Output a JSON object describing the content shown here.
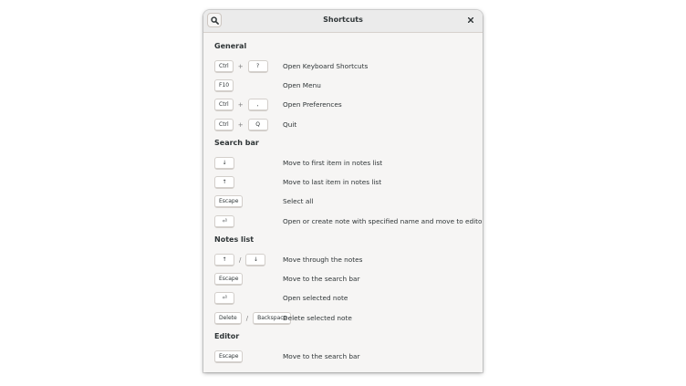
{
  "window": {
    "title": "Shortcuts"
  },
  "icons": {
    "search": "search-icon",
    "close": "close-icon"
  },
  "sections": [
    {
      "title": "General",
      "rows": [
        {
          "keys": [
            "Ctrl",
            "?"
          ],
          "sep": "+",
          "desc": "Open Keyboard Shortcuts"
        },
        {
          "keys": [
            "F10"
          ],
          "sep": "",
          "desc": "Open Menu"
        },
        {
          "keys": [
            "Ctrl",
            ","
          ],
          "sep": "+",
          "desc": "Open Preferences"
        },
        {
          "keys": [
            "Ctrl",
            "Q"
          ],
          "sep": "+",
          "desc": "Quit"
        }
      ]
    },
    {
      "title": "Search bar",
      "rows": [
        {
          "keys": [
            "↓"
          ],
          "sep": "",
          "desc": "Move to first item in notes list"
        },
        {
          "keys": [
            "↑"
          ],
          "sep": "",
          "desc": "Move to last item in notes list"
        },
        {
          "keys": [
            "Escape"
          ],
          "sep": "",
          "desc": "Select all"
        },
        {
          "keys": [
            "⏎"
          ],
          "sep": "",
          "desc": "Open or create note with specified name and move to editor"
        }
      ]
    },
    {
      "title": "Notes list",
      "rows": [
        {
          "keys": [
            "↑",
            "↓"
          ],
          "sep": "/",
          "desc": "Move through the notes"
        },
        {
          "keys": [
            "Escape"
          ],
          "sep": "",
          "desc": "Move to the search bar"
        },
        {
          "keys": [
            "⏎"
          ],
          "sep": "",
          "desc": "Open selected note"
        },
        {
          "keys": [
            "Delete",
            "Backspace"
          ],
          "sep": "/",
          "desc": "Delete selected note"
        }
      ]
    },
    {
      "title": "Editor",
      "rows": [
        {
          "keys": [
            "Escape"
          ],
          "sep": "",
          "desc": "Move to the search bar"
        }
      ]
    }
  ]
}
